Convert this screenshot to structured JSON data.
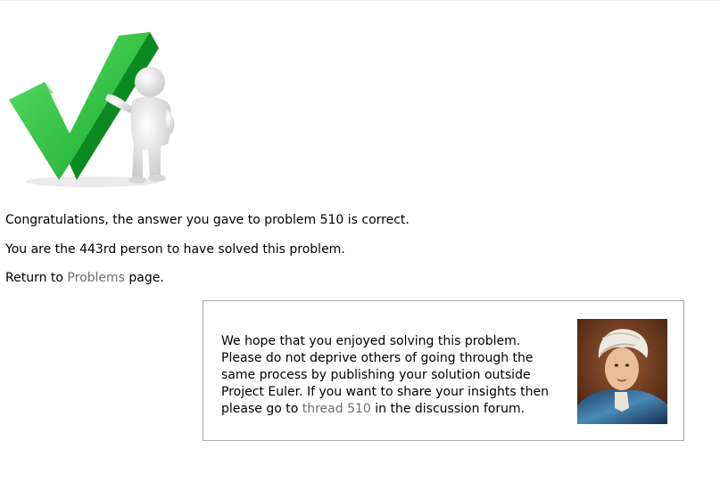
{
  "messages": {
    "congrats": "Congratulations, the answer you gave to problem 510 is correct.",
    "solver_count": "You are the 443rd person to have solved this problem.",
    "return_prefix": "Return to ",
    "return_link": "Problems",
    "return_suffix": " page."
  },
  "forum_notice": {
    "text_before_link": "We hope that you enjoyed solving this problem. Please do not deprive others of going through the same process by publishing your solution outside Project Euler. If you want to share your insights then please go to ",
    "link_text": "thread 510",
    "text_after_link": " in the discussion forum."
  },
  "colors": {
    "link": "#6f6f6f",
    "checkmark": "#22b83a",
    "box_border": "#a8a8a8"
  },
  "icons": {
    "hero": "checkmark-figure-icon",
    "portrait": "euler-portrait"
  }
}
